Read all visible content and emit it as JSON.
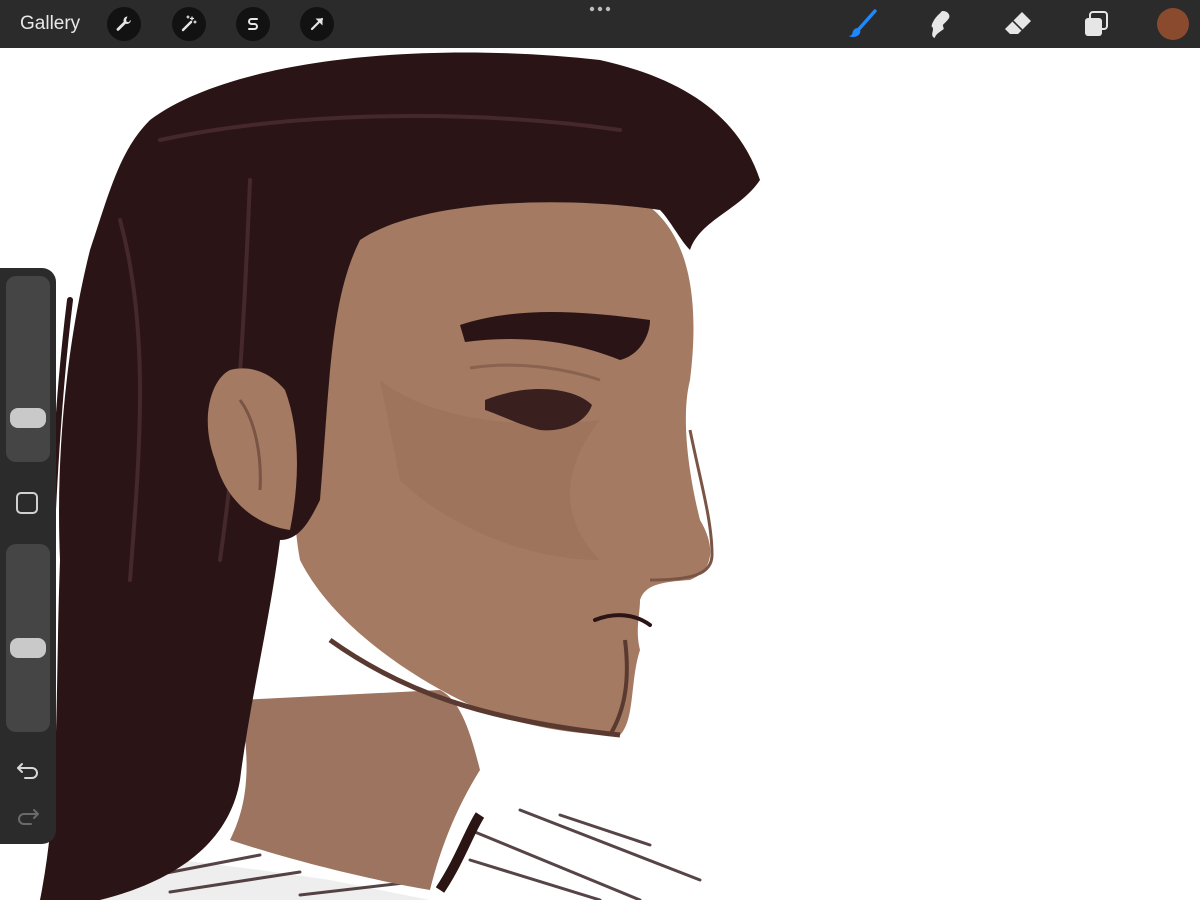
{
  "topbar": {
    "gallery_label": "Gallery",
    "left_tools": [
      {
        "icon": "wrench-icon",
        "name": "actions"
      },
      {
        "icon": "magic-wand-icon",
        "name": "adjustments"
      },
      {
        "icon": "selection-s-icon",
        "name": "selection"
      },
      {
        "icon": "arrow-cursor-icon",
        "name": "transform"
      }
    ],
    "right_tools": [
      {
        "icon": "brush-icon",
        "name": "paint",
        "active": true
      },
      {
        "icon": "smudge-icon",
        "name": "smudge"
      },
      {
        "icon": "eraser-icon",
        "name": "eraser"
      },
      {
        "icon": "layers-icon",
        "name": "layers"
      }
    ],
    "color_swatch": "#8a4a2e",
    "accent": "#1e88ff"
  },
  "sidebar": {
    "brush_size_level": 0.27,
    "opacity_level": 0.45
  }
}
